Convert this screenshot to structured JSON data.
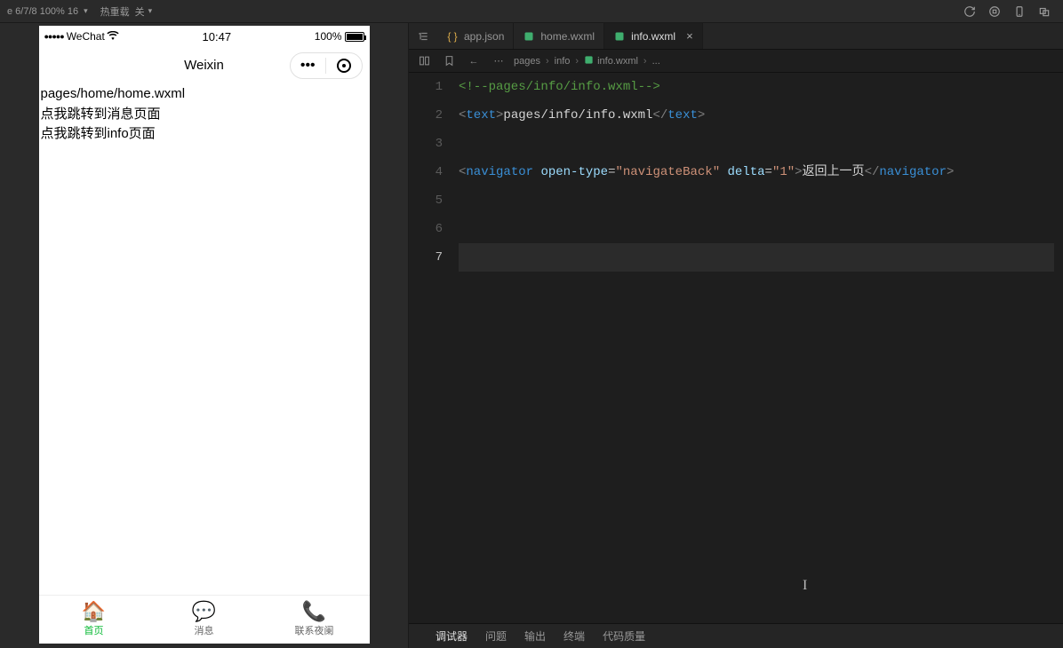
{
  "top_toolbar": {
    "device_info": "e 6/7/8 100% 16",
    "reload_label": "热重载",
    "close_label": "关"
  },
  "simulator": {
    "statusbar": {
      "carrier": "WeChat",
      "time": "10:47",
      "battery_pct": "100%"
    },
    "nav_title": "Weixin",
    "content_lines": [
      "pages/home/home.wxml",
      "点我跳转到消息页面",
      "点我跳转到info页面"
    ],
    "tabs": [
      {
        "label": "首页",
        "icon": "🏠",
        "active": true
      },
      {
        "label": "消息",
        "icon": "💬",
        "active": false
      },
      {
        "label": "联系夜阑",
        "icon": "📞",
        "active": false
      }
    ]
  },
  "editor": {
    "tabs": [
      {
        "name": "app.json",
        "type": "json",
        "active": false
      },
      {
        "name": "home.wxml",
        "type": "wxml",
        "active": false
      },
      {
        "name": "info.wxml",
        "type": "wxml",
        "active": true
      }
    ],
    "breadcrumbs": [
      "pages",
      "info",
      "info.wxml",
      "..."
    ],
    "line_numbers": [
      "1",
      "2",
      "3",
      "4",
      "5",
      "6",
      "7"
    ],
    "current_line": 7,
    "code": {
      "l1_comment": "<!--pages/info/info.wxml-->",
      "l2": {
        "tag": "text",
        "inner": "pages/info/info.wxml"
      },
      "l4": {
        "tag": "navigator",
        "attr1": "open-type",
        "val1": "navigateBack",
        "attr2": "delta",
        "val2": "1",
        "inner": "返回上一页"
      }
    }
  },
  "bottom_panel": {
    "tabs": [
      "调试器",
      "问题",
      "输出",
      "终端",
      "代码质量"
    ],
    "active_index": 0
  }
}
